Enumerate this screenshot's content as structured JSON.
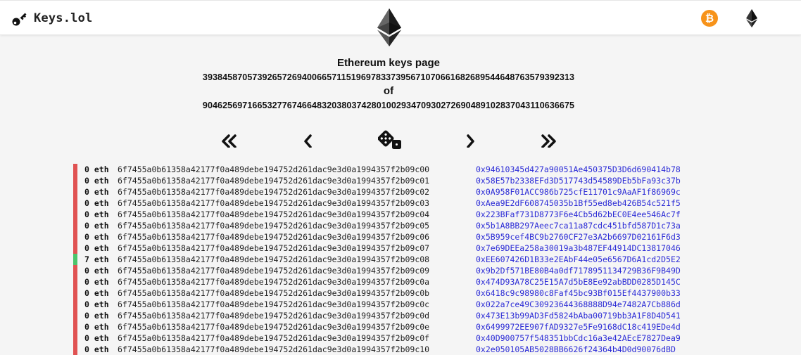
{
  "header": {
    "brand": "Keys.lol"
  },
  "heading": {
    "title": "Ethereum keys page",
    "page_number": "39384587057392657269400665711519697833739567107066168268954464876357939231 3",
    "of_label": "of",
    "total_pages": "904625697166532776746648320380374280100293470930272690489102837043110636675"
  },
  "nav": {
    "first": "first-page",
    "prev": "previous-page",
    "random": "random-page",
    "next": "next-page",
    "last": "last-page"
  },
  "colors": {
    "empty": "#e05252",
    "funded": "#4cc46b",
    "address": "#2b2bd6",
    "btc": "#f7931a"
  },
  "rows": [
    {
      "balance": "0 eth",
      "key": "6f7455a0b61358a42177f0a489debe194752d261dac9e3d0a1994357f2b09c00",
      "address": "0x94610345d427a90051Ae450375D3D6d690414b78",
      "status": "empty"
    },
    {
      "balance": "0 eth",
      "key": "6f7455a0b61358a42177f0a489debe194752d261dac9e3d0a1994357f2b09c01",
      "address": "0x58E57b2338EFd3D517743d54589DEb5bFa93c37b",
      "status": "empty"
    },
    {
      "balance": "0 eth",
      "key": "6f7455a0b61358a42177f0a489debe194752d261dac9e3d0a1994357f2b09c02",
      "address": "0x0A958F01ACC986b725cfE11701c9AaAF1f86969c",
      "status": "empty"
    },
    {
      "balance": "0 eth",
      "key": "6f7455a0b61358a42177f0a489debe194752d261dac9e3d0a1994357f2b09c03",
      "address": "0xAea9E2dF608745035b1Bf55ed8eb426B54c521f5",
      "status": "empty"
    },
    {
      "balance": "0 eth",
      "key": "6f7455a0b61358a42177f0a489debe194752d261dac9e3d0a1994357f2b09c04",
      "address": "0x223BFaf731D8773F6e4Cb5d62bEC0E4ee546Ac7f",
      "status": "empty"
    },
    {
      "balance": "0 eth",
      "key": "6f7455a0b61358a42177f0a489debe194752d261dac9e3d0a1994357f2b09c05",
      "address": "0x5b1A8BB297Aeec7ca11a87cdc451bfd587D1c73a",
      "status": "empty"
    },
    {
      "balance": "0 eth",
      "key": "6f7455a0b61358a42177f0a489debe194752d261dac9e3d0a1994357f2b09c06",
      "address": "0x5B959cef4BC9b2760CF27e3A2b6697D02161F6d3",
      "status": "empty"
    },
    {
      "balance": "0 eth",
      "key": "6f7455a0b61358a42177f0a489debe194752d261dac9e3d0a1994357f2b09c07",
      "address": "0x7e69DEEa258a30019a3b487EF44914DC13817046",
      "status": "empty"
    },
    {
      "balance": "7 eth",
      "key": "6f7455a0b61358a42177f0a489debe194752d261dac9e3d0a1994357f2b09c08",
      "address": "0xEE607426D1B33e2EAbF44e05e6567D6A1cd2D5E2",
      "status": "funded"
    },
    {
      "balance": "0 eth",
      "key": "6f7455a0b61358a42177f0a489debe194752d261dac9e3d0a1994357f2b09c09",
      "address": "0x9b2Df571BE80B4a0df7178951134729B36F9B49D",
      "status": "empty"
    },
    {
      "balance": "0 eth",
      "key": "6f7455a0b61358a42177f0a489debe194752d261dac9e3d0a1994357f2b09c0a",
      "address": "0x474D93A78C25E15A7d5bE8Ee92abBDD0285D145C",
      "status": "empty"
    },
    {
      "balance": "0 eth",
      "key": "6f7455a0b61358a42177f0a489debe194752d261dac9e3d0a1994357f2b09c0b",
      "address": "0x6418c9c98980c8Faf45bc93Bf015Ef4437900b33",
      "status": "empty"
    },
    {
      "balance": "0 eth",
      "key": "6f7455a0b61358a42177f0a489debe194752d261dac9e3d0a1994357f2b09c0c",
      "address": "0x022a7ce49C30923644368888D94e7482A7Cb886d",
      "status": "empty"
    },
    {
      "balance": "0 eth",
      "key": "6f7455a0b61358a42177f0a489debe194752d261dac9e3d0a1994357f2b09c0d",
      "address": "0x473E13b99AD3Fd5824bAba00719bb3A1F8D4D541",
      "status": "empty"
    },
    {
      "balance": "0 eth",
      "key": "6f7455a0b61358a42177f0a489debe194752d261dac9e3d0a1994357f2b09c0e",
      "address": "0x6499972EE907fAD9327e5Fe9168dC18c419EDe4d",
      "status": "empty"
    },
    {
      "balance": "0 eth",
      "key": "6f7455a0b61358a42177f0a489debe194752d261dac9e3d0a1994357f2b09c0f",
      "address": "0x40D900757f548351bbCdc16a3e42AEcE7827Dea9",
      "status": "empty"
    },
    {
      "balance": "0 eth",
      "key": "6f7455a0b61358a42177f0a489debe194752d261dac9e3d0a1994357f2b09c10",
      "address": "0x2e050105AB5028BB6626f24364b4D0d90076dBD",
      "status": "empty"
    }
  ]
}
